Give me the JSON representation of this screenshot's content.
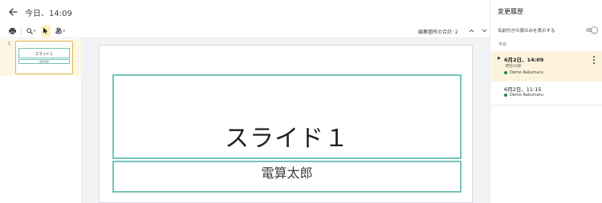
{
  "header": {
    "title": "今日、14:09"
  },
  "toolbar": {
    "font_glyph": "あ",
    "edit_count": "編集箇所の合計: 2"
  },
  "filmstrip": {
    "slides": [
      {
        "number": "1",
        "title": "スライド１",
        "subtitle": "電算太郎"
      }
    ]
  },
  "slide": {
    "title": "スライド１",
    "subtitle": "電算太郎"
  },
  "history_panel": {
    "title": "変更履歴",
    "named_only_label": "名前付きの版のみを表示する",
    "named_only_enabled": false,
    "group_label": "今日",
    "versions": [
      {
        "time": "6月2日、14:09",
        "current_label": "現在の版",
        "author": "Demo Rakumaru",
        "author_color": "#1e8e3e",
        "selected": true
      },
      {
        "time": "6月2日、11:15",
        "author": "Demo Rakumaru",
        "author_color": "#1e8e3e",
        "selected": false
      }
    ]
  },
  "colors": {
    "accent_selected": "#fdf3dd",
    "placeholder_border": "#74c4b8",
    "thumb_border": "#e0b64a"
  }
}
